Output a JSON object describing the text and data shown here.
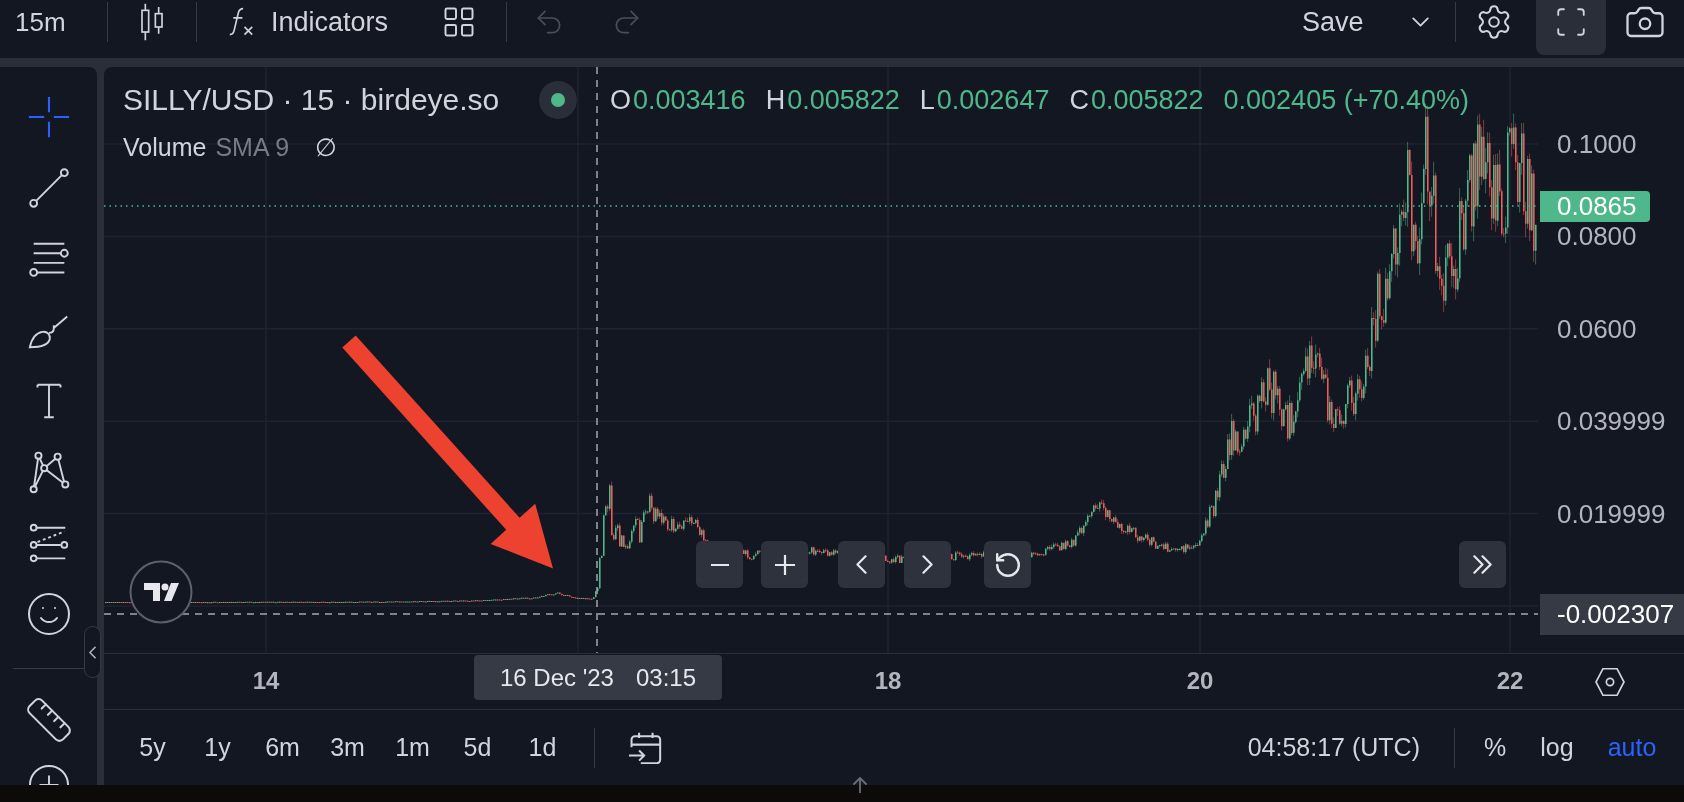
{
  "top_bar": {
    "interval": "15m",
    "indicators": "Indicators",
    "undo": {
      "disabled": true
    },
    "redo": {
      "disabled": true
    },
    "save": "Save",
    "fullscreen": {
      "active": true
    }
  },
  "drawing_tools": [
    {
      "selected": true
    },
    {
      "selected": false
    },
    {
      "selected": false
    },
    {
      "selected": false
    },
    {
      "selected": false
    },
    {
      "selected": false
    },
    {
      "selected": false
    },
    {
      "selected": false
    },
    {
      "selected": false
    },
    {
      "selected": false
    }
  ],
  "legend": {
    "title": "SILLY/USD · 15 · birdeye.so",
    "ohlc": [
      {
        "label": "O",
        "value": "0.003416"
      },
      {
        "label": "H",
        "value": "0.005822"
      },
      {
        "label": "L",
        "value": "0.002647"
      },
      {
        "label": "C",
        "value": "0.005822"
      }
    ],
    "change": "0.002405 (+70.40%)",
    "rising": true,
    "volume": {
      "name": "Volume",
      "params": "SMA 9",
      "value": "∅"
    }
  },
  "price_axis": {
    "labels": [
      "0.1000",
      "0.0800",
      "0.0600",
      "0.039999",
      "0.019999"
    ],
    "last_price": "0.0865",
    "crosshair_price": "-0.002307"
  },
  "time_axis": {
    "labels": [
      "14",
      "18",
      "20",
      "22"
    ],
    "crosshair_date": "16 Dec '23",
    "crosshair_time": "03:15"
  },
  "bottom_bar": {
    "ranges": [
      {
        "label": "5y",
        "selected": false
      },
      {
        "label": "1y",
        "selected": false
      },
      {
        "label": "6m",
        "selected": false
      },
      {
        "label": "3m",
        "selected": false
      },
      {
        "label": "1m",
        "selected": false
      },
      {
        "label": "5d",
        "selected": false
      },
      {
        "label": "1d",
        "selected": false
      }
    ],
    "clock": "04:58:17 (UTC)",
    "scale_modes": [
      {
        "label": "%",
        "selected": false
      },
      {
        "label": "log",
        "selected": false
      },
      {
        "label": "auto",
        "selected": true
      }
    ]
  }
}
